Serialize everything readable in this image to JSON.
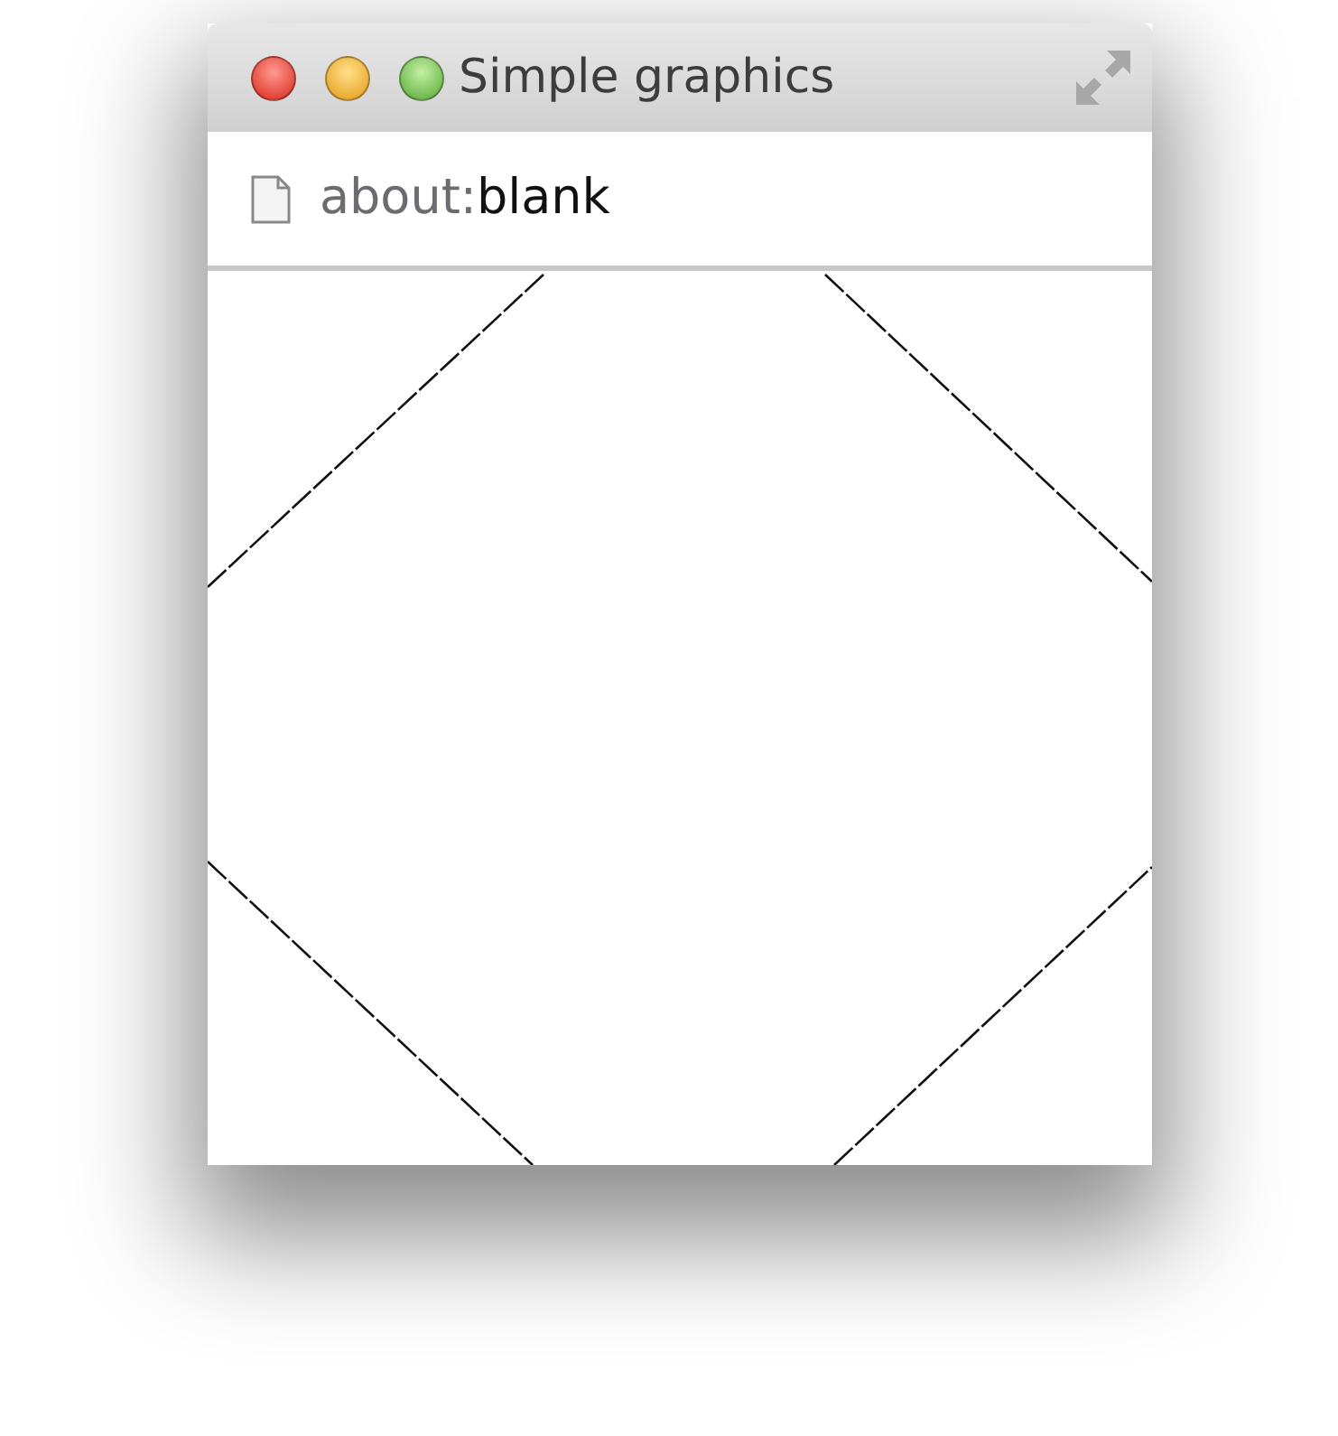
{
  "window": {
    "title": "Simple graphics"
  },
  "address_bar": {
    "scheme": "about:",
    "path": "blank"
  }
}
